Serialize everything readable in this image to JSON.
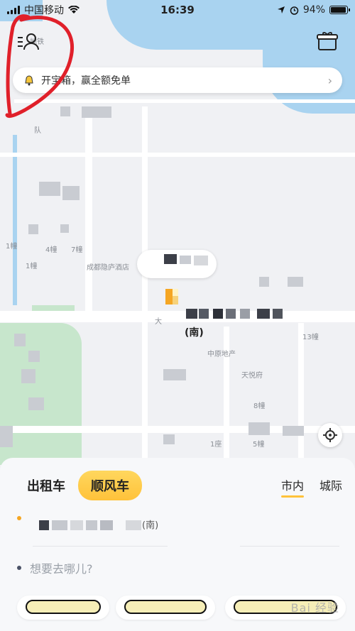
{
  "status_bar": {
    "carrier": "中国移动",
    "time": "16:39",
    "battery": "94%"
  },
  "banner": {
    "text": "开宝箱，赢全额免单"
  },
  "map": {
    "labels": [
      {
        "text": "地铁",
        "id": "subway"
      },
      {
        "text": "4幢",
        "id": "b4"
      },
      {
        "text": "7幢",
        "id": "b7"
      },
      {
        "text": "1幢",
        "id": "b1a"
      },
      {
        "text": "1幢",
        "id": "b1b"
      },
      {
        "text": "成都隐庐酒店",
        "id": "hotel"
      },
      {
        "text": "大",
        "id": "da"
      },
      {
        "text": "中原地产",
        "id": "zhongyuan"
      },
      {
        "text": "天悦府",
        "id": "tianyue"
      },
      {
        "text": "13幢",
        "id": "b13"
      },
      {
        "text": "8幢",
        "id": "b8"
      },
      {
        "text": "1座",
        "id": "z1"
      },
      {
        "text": "5幢",
        "id": "b5"
      },
      {
        "text": "队",
        "id": "dui"
      }
    ],
    "pin_caption": "(南)"
  },
  "panel": {
    "tabs": [
      "出租车",
      "顺风车"
    ],
    "active_tab": "顺风车",
    "scope_tabs": [
      "市内",
      "城际"
    ],
    "active_scope": "市内",
    "from_text": "(南)",
    "to_placeholder": "想要去哪儿?"
  },
  "watermark": "Bai 经验",
  "colors": {
    "accent": "#ffc23a",
    "water": "#a9d3f0",
    "park": "#c7e6cc",
    "annotation": "#e0202a"
  }
}
